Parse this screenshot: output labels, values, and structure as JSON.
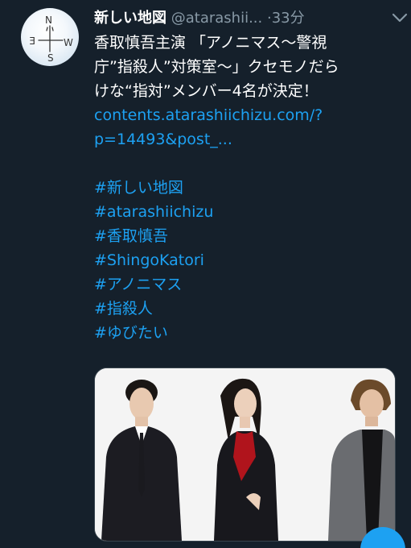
{
  "tweet": {
    "display_name": "新しい地図",
    "handle": "@atarashii...",
    "separator": "·",
    "time": "33分",
    "text_lines": [
      "香取慎吾主演 「アノニマス〜警視",
      "庁”指殺人”対策室〜」クセモノだら",
      "けな“指対”メンバー4名が決定！"
    ],
    "link_lines": [
      "contents.atarashiichizu.com/?",
      "p=14493&post_..."
    ],
    "hashtags": [
      "#新しい地図",
      "#atarashiichizu",
      "#香取慎吾",
      "#ShingoKatori",
      "#アノニマス",
      "#指殺人",
      "#ゆびたい"
    ]
  },
  "avatar": {
    "letters": [
      "N",
      "E",
      "W",
      "S"
    ]
  },
  "icons": {
    "more": "chevron-down-icon",
    "compose": "compose-fab"
  },
  "colors": {
    "background": "#15202b",
    "text": "#ffffff",
    "muted": "#8899a6",
    "link": "#1da1f2"
  }
}
